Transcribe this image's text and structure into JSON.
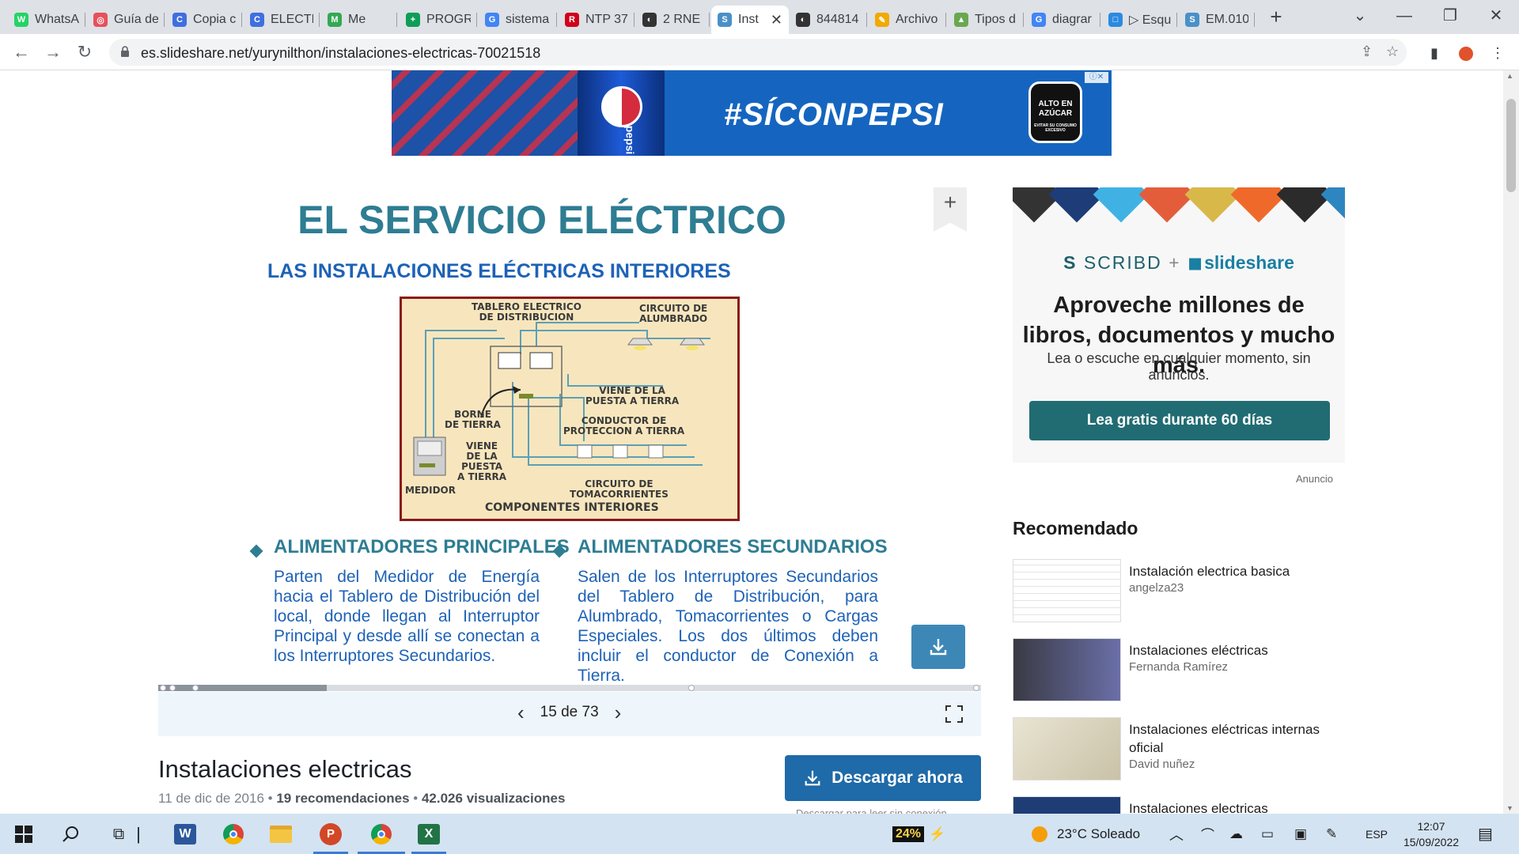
{
  "browser": {
    "tabs": [
      {
        "label": "WhatsA",
        "color": "#25d366",
        "glyph": "W"
      },
      {
        "label": "Guía de",
        "color": "#e8505b",
        "glyph": "◎"
      },
      {
        "label": "Copia c",
        "color": "#3f6fdf",
        "glyph": "C"
      },
      {
        "label": "ELECTR",
        "color": "#3f6fdf",
        "glyph": "C"
      },
      {
        "label": "Me",
        "color": "#34a853",
        "glyph": "M"
      },
      {
        "label": "PROGR",
        "color": "#0f9d58",
        "glyph": "+"
      },
      {
        "label": "sistema",
        "color": "#4285f4",
        "glyph": "G"
      },
      {
        "label": "NTP 37",
        "color": "#d0021b",
        "glyph": "R"
      },
      {
        "label": "2 RNE I",
        "color": "#333333",
        "glyph": "◐"
      },
      {
        "label": "Inst",
        "color": "#4a90c8",
        "glyph": "S",
        "active": true
      },
      {
        "label": "844814",
        "color": "#333333",
        "glyph": "◐"
      },
      {
        "label": "Archivo",
        "color": "#f2a900",
        "glyph": "✎"
      },
      {
        "label": "Tipos d",
        "color": "#6aa84f",
        "glyph": "▲"
      },
      {
        "label": "diagrar",
        "color": "#4285f4",
        "glyph": "G"
      },
      {
        "label": "▷ Esqu",
        "color": "#2b8ae0",
        "glyph": "□"
      },
      {
        "label": "EM.010",
        "color": "#4a90c8",
        "glyph": "S"
      }
    ],
    "url": "es.slideshare.net/yurynilthon/instalaciones-electricas-70021518"
  },
  "ad_top": {
    "tagline": "#SÍCONPEPSI",
    "can_text": "pepsi",
    "warning": "ALTO EN AZÚCAR",
    "warning_small": "EVITAR SU CONSUMO EXCESIVO"
  },
  "slide": {
    "title": "EL SERVICIO ELÉCTRICO",
    "subtitle": "LAS INSTALACIONES ELÉCTRICAS INTERIORES",
    "diagram_labels": {
      "tablero": "TABLERO ELECTRICO\nDE DISTRIBUCION",
      "circuito_alumbrado": "CIRCUITO DE\nALUMBRADO",
      "viene_puesta": "VIENE DE LA\nPUESTA A TIERRA",
      "borne": "BORNE\nDE TIERRA",
      "conductor": "CONDUCTOR DE\nPROTECCION A TIERRA",
      "viene_left": "VIENE\nDE LA\nPUESTA\nA TIERRA",
      "medidor": "MEDIDOR",
      "circuito_toma": "CIRCUITO DE\nTOMACORRIENTES",
      "componentes": "COMPONENTES INTERIORES"
    },
    "col1_heading": "ALIMENTADORES PRINCIPALES",
    "col1_text": "Parten del Medidor de Energía hacia el Tablero de Distribución del local, donde llegan al Interruptor Principal y desde allí se conectan a los Interruptores Secundarios.",
    "col2_heading": "ALIMENTADORES SECUNDARIOS",
    "col2_text": "Salen de los Interruptores Secundarios del Tablero de Distribución, para Alumbrado, Tomacorrientes o Cargas Especiales. Los dos últimos deben incluir el conductor de Conexión a Tierra."
  },
  "viewer": {
    "current_page": 15,
    "total_pages": 73,
    "page_label": "15 de 73",
    "progress_fraction": 0.205
  },
  "document": {
    "title": "Instalaciones electricas",
    "date": "11 de dic de 2016",
    "recommendations": "19 recomendaciones",
    "views": "42.026 visualizaciones",
    "download_label": "Descargar ahora",
    "download_note": "Descargar para leer sin conexión"
  },
  "promo": {
    "brand_left": "SCRIBD",
    "plus": "+",
    "brand_right": "slideshare",
    "heading": "Aproveche millones de libros, documentos y mucho más.",
    "subtext": "Lea o escuche en cualquier momento, sin anuncios.",
    "cta": "Lea gratis durante 60 días",
    "ad_label": "Anuncio"
  },
  "recommended": {
    "heading": "Recomendado",
    "items": [
      {
        "title": "Instalación electrica basica",
        "author": "angelza23"
      },
      {
        "title": "Instalaciones eléctricas",
        "author": "Fernanda Ramírez"
      },
      {
        "title": "Instalaciones eléctricas internas oficial",
        "author": "David nuñez"
      },
      {
        "title": "Instalaciones electricas",
        "author": ""
      }
    ]
  },
  "taskbar": {
    "battery": "24%",
    "weather": "23°C  Soleado",
    "lang": "ESP",
    "time": "12:07",
    "date": "15/09/2022"
  }
}
